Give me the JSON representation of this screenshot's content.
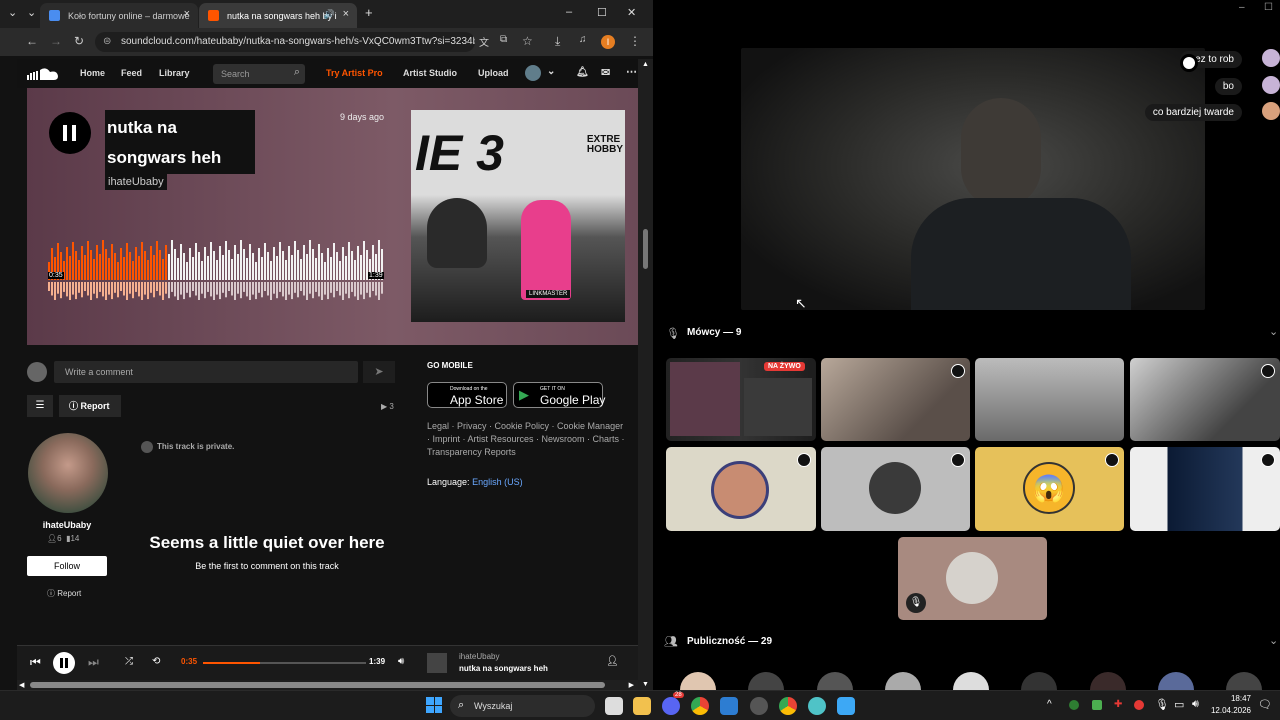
{
  "browser": {
    "tabs": [
      {
        "title": "Koło fortuny online – darmowe",
        "close": "×"
      },
      {
        "title": "nutka na songwars heh by i",
        "close": "×"
      }
    ],
    "new_tab": "+",
    "url": "soundcloud.com/hateubaby/nutka-na-songwars-heh/s-VxQC0wm3Ttw?si=3234b4...",
    "window_controls": {
      "minimize": "–",
      "maximize": "☐",
      "close": "✕"
    },
    "profile_initial": "I"
  },
  "soundcloud": {
    "nav": {
      "home": "Home",
      "feed": "Feed",
      "library": "Library",
      "search_placeholder": "Search",
      "try_artist_pro": "Try Artist Pro",
      "artist_studio": "Artist Studio",
      "upload": "Upload"
    },
    "track": {
      "title_line1": "nutka na",
      "title_line2": "songwars heh",
      "artist": "ihateUbaby",
      "posted": "9 days ago",
      "time_current": "0:35",
      "time_total": "1:39",
      "progress": 0.35
    },
    "artwork": {
      "brand": "EXTRE\nHOBBY",
      "big_text": "IE 3",
      "badge": "LINKMASTER"
    },
    "comment_placeholder": "Write a comment",
    "report_label": "Report",
    "plays": "3",
    "private_notice": "This track is private.",
    "quiet_title": "Seems a little quiet over here",
    "quiet_sub": "Be the first to comment on this track",
    "user": {
      "name": "ihateUbaby",
      "followers": "6",
      "tracks": "14",
      "follow_label": "Follow",
      "report_label": "Report"
    },
    "go_mobile": "GO MOBILE",
    "app_store": {
      "small": "Download on the",
      "big": "App Store"
    },
    "google_play": {
      "small": "GET IT ON",
      "big": "Google Play"
    },
    "footer_links": "Legal · Privacy · Cookie Policy · Cookie Manager · Imprint · Artist Resources · Newsroom · Charts · Transparency Reports",
    "language_label": "Language:",
    "language_value": "English (US)",
    "player": {
      "time_current": "0:35",
      "time_total": "1:39",
      "artist": "ihateUbaby",
      "title": "nutka na songwars heh"
    }
  },
  "discord": {
    "chat": [
      {
        "text": "wez to rob"
      },
      {
        "text": "bo"
      },
      {
        "text": "co bardziej twarde"
      }
    ],
    "speakers_header": "Mówcy — 9",
    "live_badge": "NA ŻYWO",
    "audience_header": "Publiczność — 29"
  },
  "taskbar": {
    "search_placeholder": "Wyszukaj",
    "time": "18:47",
    "date": "12.04.2026",
    "discord_badge": "28"
  },
  "colors": {
    "soundcloud_orange": "#ff5500",
    "discord_bg": "#000000",
    "hero_bg": "#6e4d5b"
  }
}
